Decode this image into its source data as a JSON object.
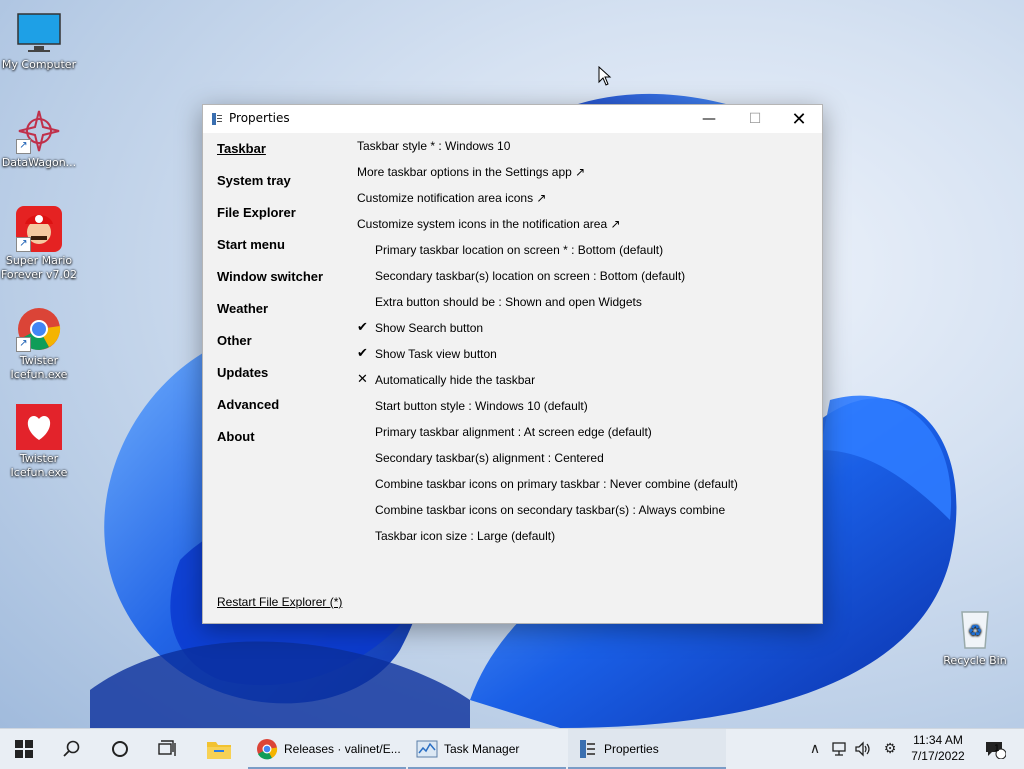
{
  "desktop": {
    "icons": [
      {
        "label": "My Computer"
      },
      {
        "label": "DataWagon..."
      },
      {
        "label": "Super Mario Forever v7.02"
      },
      {
        "label": "Twister Icefun.exe"
      },
      {
        "label": "Twister Icefun.exe"
      },
      {
        "label": "Recycle Bin"
      }
    ]
  },
  "window": {
    "title": "Properties",
    "nav": [
      {
        "label": "Taskbar",
        "active": true
      },
      {
        "label": "System tray"
      },
      {
        "label": "File Explorer"
      },
      {
        "label": "Start menu"
      },
      {
        "label": "Window switcher"
      },
      {
        "label": "Weather"
      },
      {
        "label": "Other"
      },
      {
        "label": "Updates"
      },
      {
        "label": "Advanced"
      },
      {
        "label": "About"
      }
    ],
    "options": [
      {
        "text": "Taskbar style * : Windows 10"
      },
      {
        "text": "More taskbar options in the Settings app ↗"
      },
      {
        "text": "Customize notification area icons ↗"
      },
      {
        "text": "Customize system icons in the notification area ↗"
      },
      {
        "text": "Primary taskbar location on screen * : Bottom (default)"
      },
      {
        "text": "Secondary taskbar(s) location on screen : Bottom (default)"
      },
      {
        "text": "Extra button should be : Shown and open Widgets"
      },
      {
        "text": "Show Search button",
        "mark": "✔"
      },
      {
        "text": "Show Task view button",
        "mark": "✔"
      },
      {
        "text": "Automatically hide the taskbar",
        "mark": "✕"
      },
      {
        "text": "Start button style : Windows 10 (default)"
      },
      {
        "text": "Primary taskbar alignment : At screen edge (default)"
      },
      {
        "text": "Secondary taskbar(s) alignment : Centered"
      },
      {
        "text": "Combine taskbar icons on primary taskbar : Never combine (default)"
      },
      {
        "text": "Combine taskbar icons on secondary taskbar(s) : Always combine"
      },
      {
        "text": "Taskbar icon size : Large (default)"
      }
    ],
    "restart_link": "Restart File Explorer (*)"
  },
  "taskbar": {
    "apps": [
      {
        "label": "Releases · valinet/E...",
        "icon": "chrome-icon"
      },
      {
        "label": "Task Manager",
        "icon": "task-manager-icon"
      },
      {
        "label": "Properties",
        "icon": "properties-icon"
      }
    ],
    "clock": {
      "time": "11:34 AM",
      "date": "7/17/2022"
    },
    "notification_count": "1"
  },
  "colors": {
    "accent": "#1a5fb4",
    "wallpaper_bloom": "#0b4fd8"
  }
}
